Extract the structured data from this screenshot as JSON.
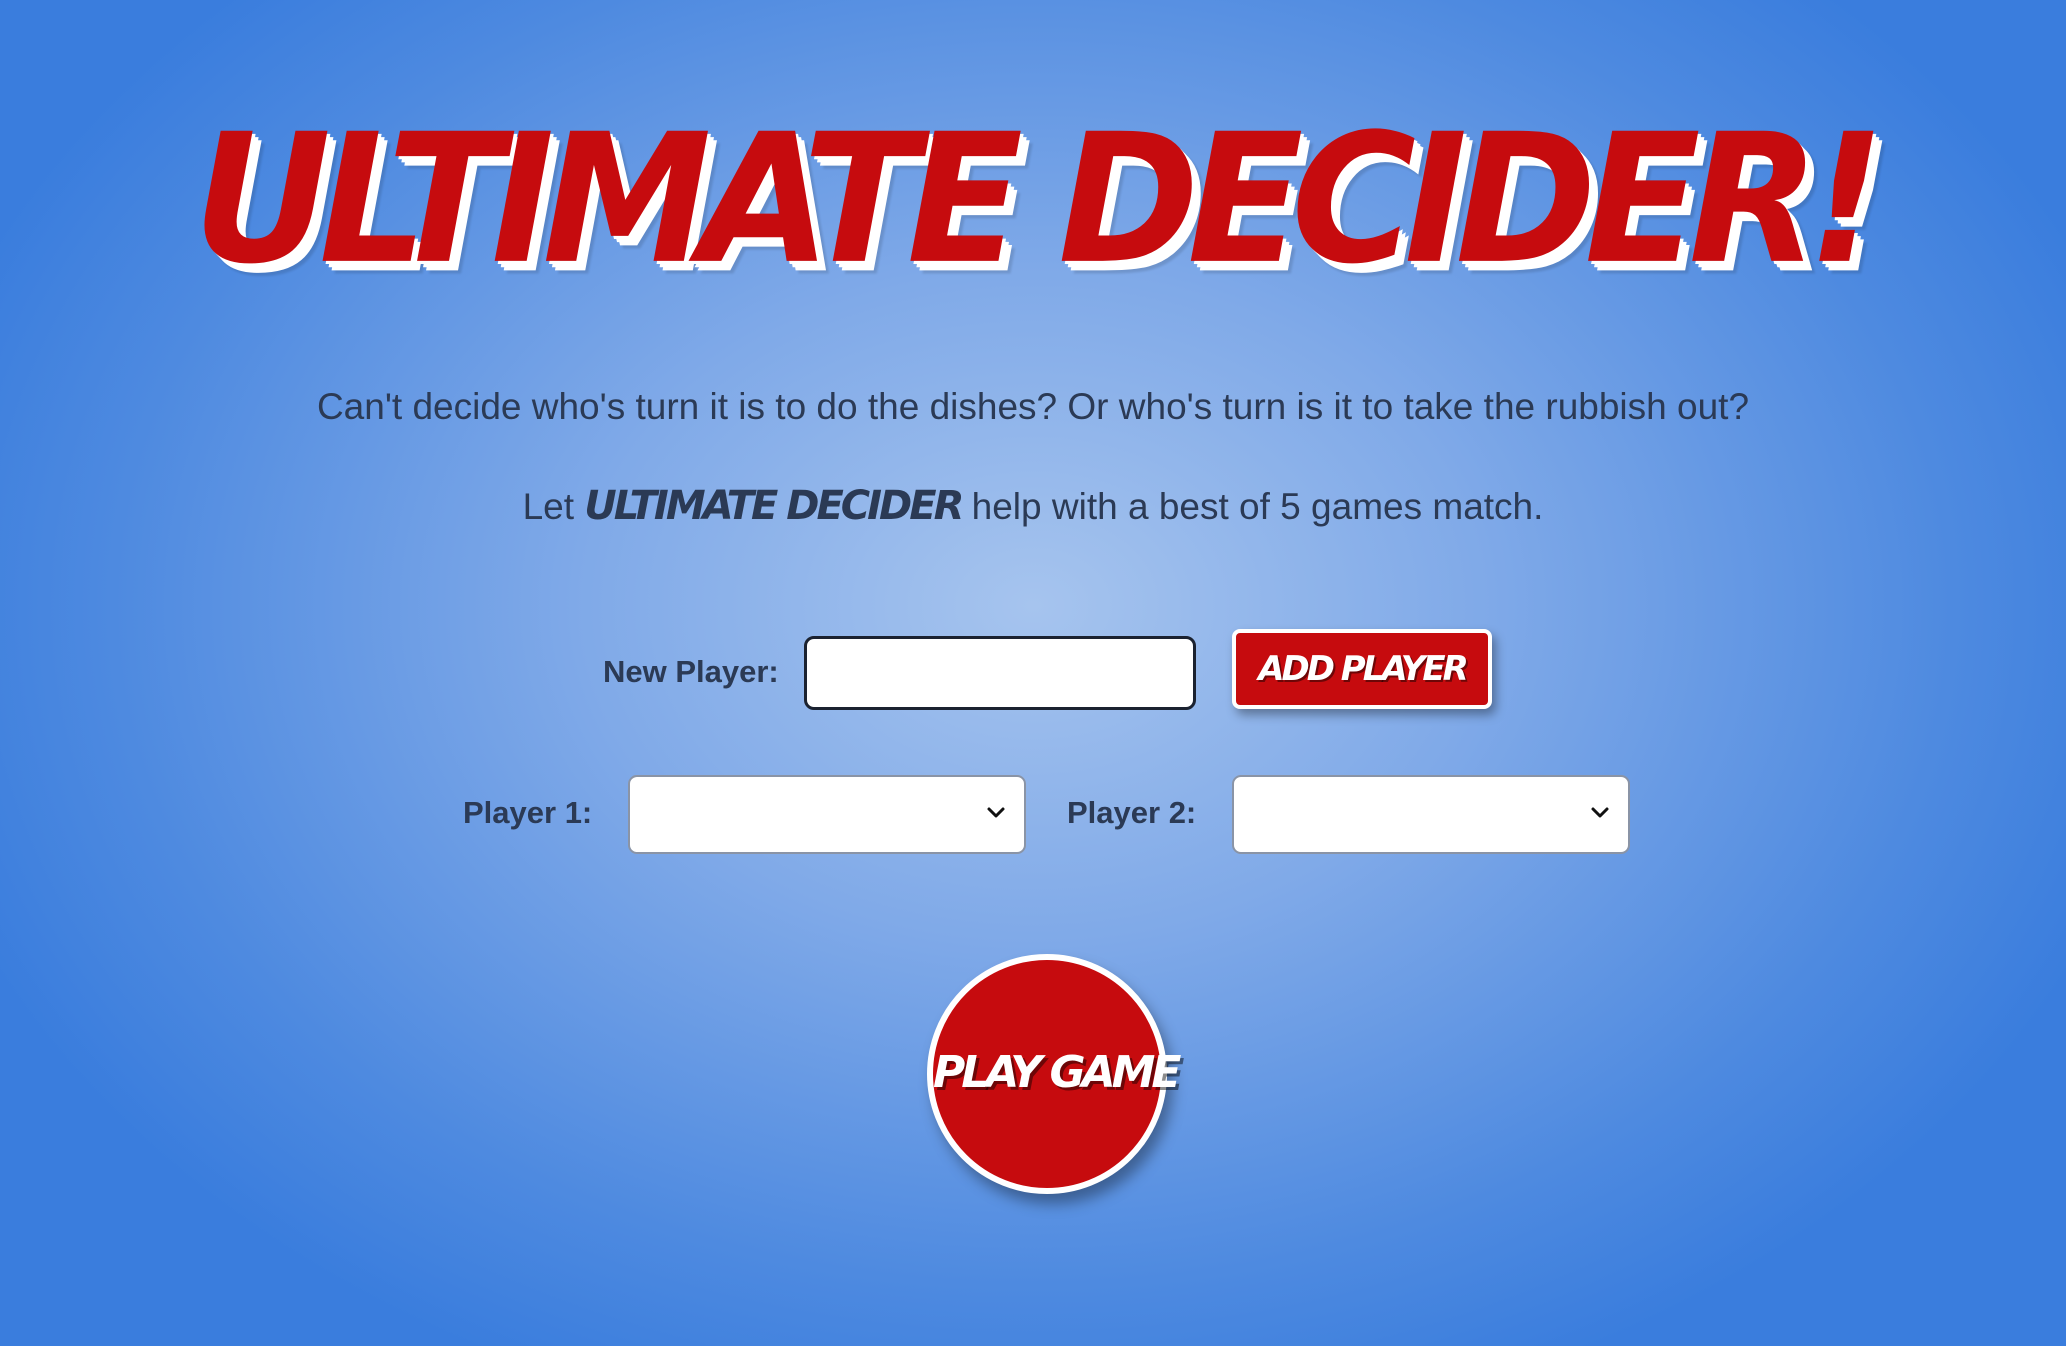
{
  "header": {
    "title": "ULTIMATE DECIDER!"
  },
  "intro": {
    "line1": "Can't decide who's turn it is to do the dishes? Or who's turn is it to take the rubbish out?",
    "line2_prefix": "Let ",
    "line2_brand": "ULTIMATE DECIDER",
    "line2_suffix": " help with a best of 5 games match."
  },
  "new_player": {
    "label": "New Player:",
    "value": "",
    "placeholder": "",
    "add_button_label": "ADD PLAYER"
  },
  "players": {
    "player1_label": "Player 1:",
    "player1_value": "",
    "player2_label": "Player 2:",
    "player2_value": ""
  },
  "play": {
    "button_label": "PLAY GAME"
  },
  "colors": {
    "accent_red": "#c60b0e",
    "text_dark": "#2b3a55",
    "background_blue": "#4e8ae0"
  }
}
